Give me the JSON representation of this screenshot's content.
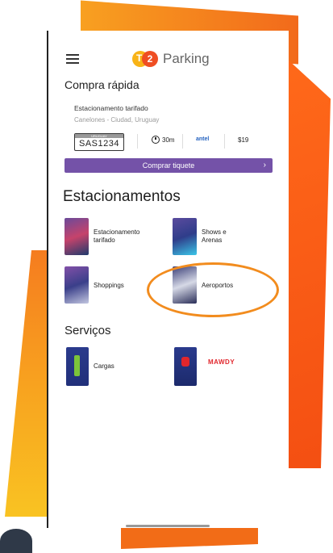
{
  "header": {
    "app_name": "Parking",
    "logo_letter": "2",
    "logo_letter_t": "T"
  },
  "quick_buy": {
    "title": "Compra rápida",
    "location": "Estacionamento tarifado",
    "sublocation": "Canelones - Ciudad, Uruguay",
    "plate_country": "URUGUAY",
    "plate": "SAS1234",
    "duration": "30m",
    "carrier": "antel",
    "price": "$19",
    "button_label": "Comprar tiquete",
    "button_chevron": "›"
  },
  "parking_section": {
    "title": "Estacionamentos",
    "items": [
      {
        "label": "Estacionamento tarifado",
        "icon": "parking-meter-icon"
      },
      {
        "label": "Shows e Arenas",
        "icon": "arena-icon"
      },
      {
        "label": "Shoppings",
        "icon": "shopping-icon"
      },
      {
        "label": "Aeroportos",
        "icon": "airplane-icon"
      }
    ]
  },
  "services_section": {
    "title": "Serviços",
    "items": [
      {
        "label": "Cargas",
        "icon": "charging-icon"
      },
      {
        "label": "MAWDY",
        "icon": "mawdy-icon"
      }
    ]
  },
  "colors": {
    "accent": "#7452a8",
    "orange": "#f26a1b",
    "yellow": "#f8b317",
    "highlight": "#f28c1e"
  }
}
